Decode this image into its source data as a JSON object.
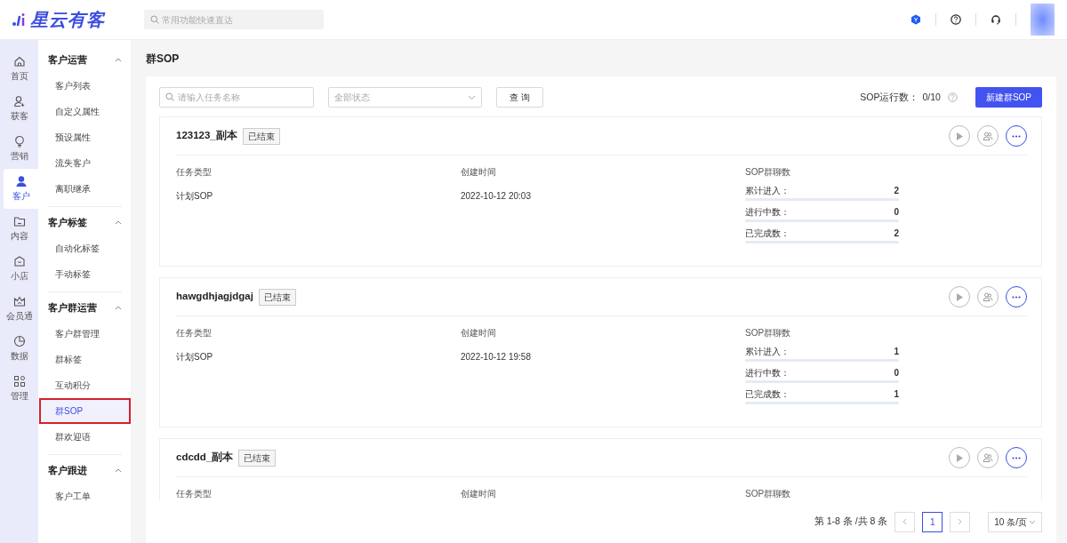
{
  "header": {
    "logo_text": "星云有客",
    "search": {
      "placeholder": "常用功能快速直达"
    }
  },
  "rail": [
    {
      "label": "首页",
      "selected": false
    },
    {
      "label": "获客",
      "selected": false
    },
    {
      "label": "营销",
      "selected": false
    },
    {
      "label": "客户",
      "selected": true
    },
    {
      "label": "内容",
      "selected": false
    },
    {
      "label": "小店",
      "selected": false
    },
    {
      "label": "会员通",
      "selected": false
    },
    {
      "label": "数据",
      "selected": false
    },
    {
      "label": "管理",
      "selected": false
    }
  ],
  "sidebar": [
    {
      "title": "客户运营",
      "expanded": true,
      "items": [
        {
          "label": "客户列表",
          "selected": false
        },
        {
          "label": "自定义属性",
          "selected": false
        },
        {
          "label": "预设属性",
          "selected": false
        },
        {
          "label": "流失客户",
          "selected": false
        },
        {
          "label": "离职继承",
          "selected": false
        }
      ]
    },
    {
      "title": "客户标签",
      "expanded": true,
      "items": [
        {
          "label": "自动化标签",
          "selected": false
        },
        {
          "label": "手动标签",
          "selected": false
        }
      ]
    },
    {
      "title": "客户群运营",
      "expanded": true,
      "items": [
        {
          "label": "客户群管理",
          "selected": false
        },
        {
          "label": "群标签",
          "selected": false
        },
        {
          "label": "互动积分",
          "selected": false
        },
        {
          "label": "群SOP",
          "selected": true,
          "annotated": true
        },
        {
          "label": "群欢迎语",
          "selected": false
        }
      ]
    },
    {
      "title": "客户跟进",
      "expanded": true,
      "items": [
        {
          "label": "客户工单",
          "selected": false
        }
      ]
    }
  ],
  "page_title": "群SOP",
  "toolbar": {
    "search": {
      "placeholder": "请输入任务名称"
    },
    "status_select": {
      "value": "全部状态"
    },
    "query_button": "查 询",
    "run_count_label": "SOP运行数：",
    "run_count": "0/10",
    "new_button": "新建群SOP"
  },
  "cards": [
    {
      "name": "123123_副本",
      "status": "已结束",
      "columns": [
        {
          "label": "任务类型",
          "value": "计划SOP"
        },
        {
          "label": "创建时间",
          "value": "2022-10-12 20:03"
        }
      ],
      "stats_title": "SOP群聊数",
      "stats": [
        {
          "label": "累计进入：",
          "value": "2"
        },
        {
          "label": "进行中数：",
          "value": "0"
        },
        {
          "label": "已完成数：",
          "value": "2"
        }
      ]
    },
    {
      "name": "hawgdhjagjdgaj",
      "status": "已结束",
      "columns": [
        {
          "label": "任务类型",
          "value": "计划SOP"
        },
        {
          "label": "创建时间",
          "value": "2022-10-12 19:58"
        }
      ],
      "stats_title": "SOP群聊数",
      "stats": [
        {
          "label": "累计进入：",
          "value": "1"
        },
        {
          "label": "进行中数：",
          "value": "0"
        },
        {
          "label": "已完成数：",
          "value": "1"
        }
      ]
    },
    {
      "name": "cdcdd_副本",
      "status": "已结束",
      "columns": [
        {
          "label": "任务类型"
        },
        {
          "label": "创建时间"
        }
      ],
      "stats_title": "SOP群聊数"
    }
  ],
  "pagination": {
    "summary": "第 1-8 条 /共 8 条",
    "pages": [
      {
        "label": "1",
        "selected": true
      }
    ],
    "page_size": "10 条/页"
  }
}
